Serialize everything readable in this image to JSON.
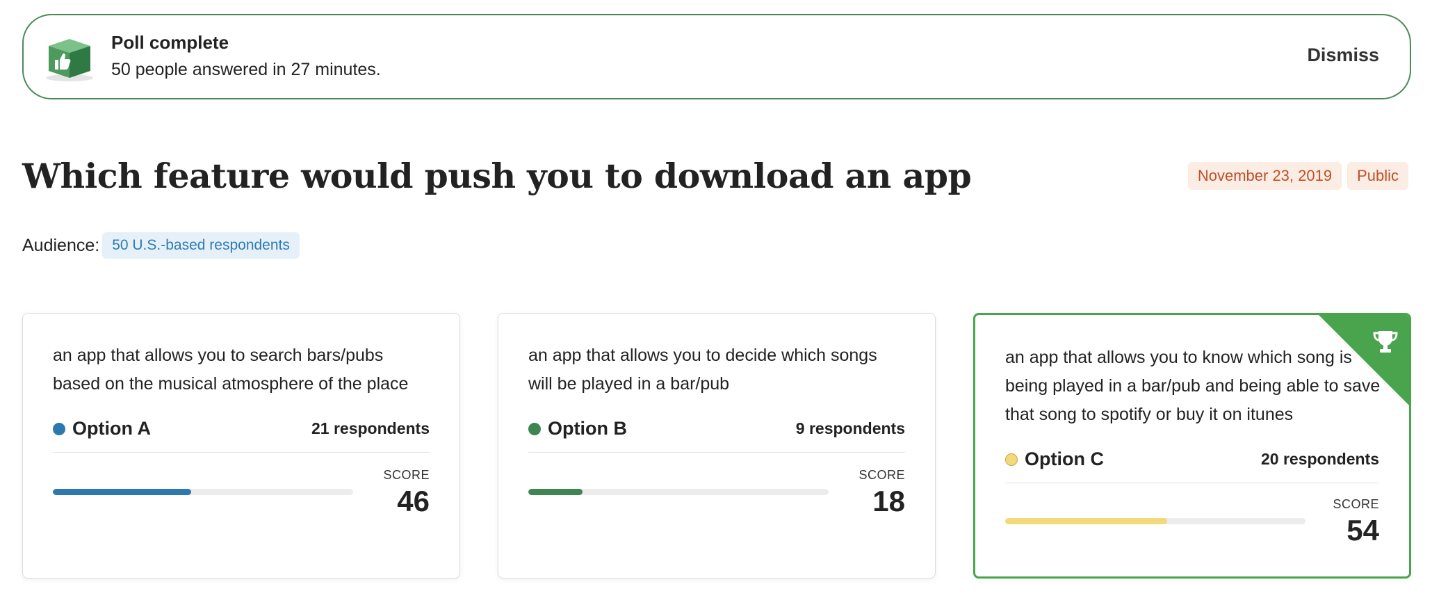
{
  "banner": {
    "title": "Poll complete",
    "subtitle": "50 people answered in 27 minutes.",
    "dismiss_label": "Dismiss",
    "icon": "thumbs-up-box-icon",
    "border_color": "#4a8a5a"
  },
  "poll": {
    "title": "Which feature would push you to download an app",
    "date": "November 23, 2019",
    "visibility": "Public",
    "audience_label": "Audience:",
    "audience_value": "50 U.S.-based respondents"
  },
  "options": [
    {
      "description": "an app that allows you to search bars/pubs based on the musical atmosphere of the place",
      "name": "Option A",
      "respondents": "21 respondents",
      "score_label": "SCORE",
      "score": "46",
      "score_value": 46,
      "color": "#2e78b0",
      "winner": false
    },
    {
      "description": "an app that allows you to decide which songs will be played in a bar/pub",
      "name": "Option B",
      "respondents": "9 respondents",
      "score_label": "SCORE",
      "score": "18",
      "score_value": 18,
      "color": "#3f8552",
      "winner": false
    },
    {
      "description": "an app that allows you to know which song is being played in a bar/pub and being able to save that song to spotify or buy it on itunes",
      "name": "Option C",
      "respondents": "20 respondents",
      "score_label": "SCORE",
      "score": "54",
      "score_value": 54,
      "color": "#f2d97c",
      "winner": true,
      "winner_icon": "trophy-icon"
    }
  ]
}
